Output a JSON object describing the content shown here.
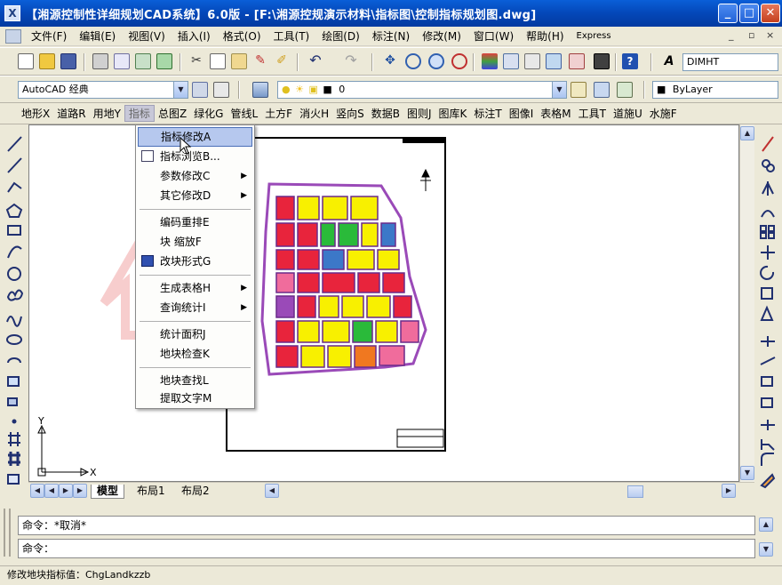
{
  "window": {
    "title": "【湘源控制性详细规划CAD系统】6.0版 - [F:\\湘源控规演示材料\\指标图\\控制指标规划图.dwg]",
    "controls": [
      "_",
      "□",
      "✕"
    ]
  },
  "menubar": {
    "items": [
      "文件(F)",
      "编辑(E)",
      "视图(V)",
      "插入(I)",
      "格式(O)",
      "工具(T)",
      "绘图(D)",
      "标注(N)",
      "修改(M)",
      "窗口(W)",
      "帮助(H)",
      "Express"
    ],
    "mdi_controls": [
      "_",
      "▫",
      "×"
    ]
  },
  "toolbar2": {
    "workspace": "AutoCAD 经典",
    "layer": "0",
    "color": "ByLayer",
    "style": "DIMHT"
  },
  "ccss_menu": {
    "items": [
      "地形X",
      "道路R",
      "用地Y",
      "指标",
      "总图Z",
      "绿化G",
      "管线L",
      "土方F",
      "消火H",
      "竖向S",
      "数据B",
      "图则J",
      "图库K",
      "标注T",
      "图像I",
      "表格M",
      "工具T",
      "道施U",
      "水施F"
    ]
  },
  "dropdown": {
    "items": [
      {
        "label": "指标修改A",
        "highlight": true,
        "submenu": false
      },
      {
        "label": "指标浏览B...",
        "highlight": false,
        "submenu": false
      },
      {
        "label": "参数修改C",
        "highlight": false,
        "submenu": true
      },
      {
        "label": "其它修改D",
        "highlight": false,
        "submenu": true
      },
      {
        "label": "编码重排E",
        "highlight": false,
        "submenu": false
      },
      {
        "label": "块  缩放F",
        "highlight": false,
        "submenu": false
      },
      {
        "label": "改块形式G",
        "highlight": false,
        "submenu": false
      },
      {
        "label": "生成表格H",
        "highlight": false,
        "submenu": true
      },
      {
        "label": "查询统计I",
        "highlight": false,
        "submenu": true
      },
      {
        "label": "统计面积J",
        "highlight": false,
        "submenu": false
      },
      {
        "label": "地块检查K",
        "highlight": false,
        "submenu": false
      },
      {
        "label": "地块查找L",
        "highlight": false,
        "submenu": false
      },
      {
        "label": "提取文字M",
        "highlight": false,
        "submenu": false
      }
    ]
  },
  "layout_tabs": [
    "模型",
    "布局1",
    "布局2"
  ],
  "ucs": {
    "x_label": "X",
    "y_label": "Y"
  },
  "command": {
    "line1": "命令：*取消*",
    "line2": "命令："
  },
  "status": {
    "text": "修改地块指标值：ChgLandkzzb"
  },
  "colors": {
    "titlebar": "#0a5fd8",
    "highlight": "#b6c8ee",
    "parcel_red": "#e8243c",
    "parcel_yellow": "#f8f000",
    "parcel_green": "#2aba3a",
    "parcel_purple": "#9a4ab8",
    "parcel_pink": "#f06c9c",
    "parcel_blue": "#3c78c8",
    "parcel_orange": "#f07820"
  }
}
